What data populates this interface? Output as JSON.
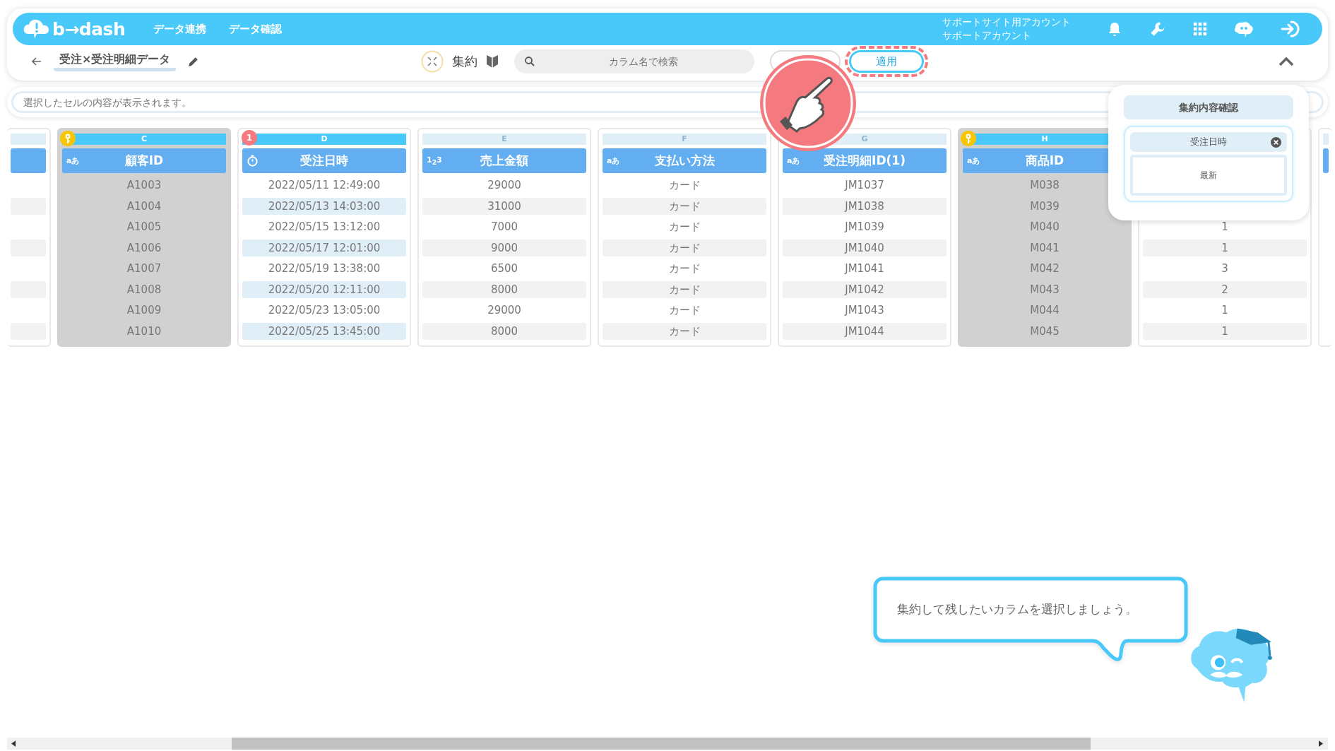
{
  "app": {
    "logo": "b→dash",
    "nav": [
      {
        "label": "データ連携"
      },
      {
        "label": "データ確認"
      }
    ],
    "account": [
      "サポートサイト用アカウント",
      "サポートアカウント"
    ]
  },
  "toolbar": {
    "title": "受注×受注明細データ",
    "mode_label": "集約",
    "search": {
      "placeholder": "カラム名で検索"
    },
    "apply_button": {
      "label": "適用",
      "highlighted": true
    }
  },
  "cell_view": {
    "placeholder": "選択したセルの内容が表示されます。"
  },
  "columns": [
    {
      "letter": "C",
      "kind": "text",
      "type_label": "aあ",
      "name": "顧客ID",
      "key": true,
      "cells": [
        "A1003",
        "A1004",
        "A1005",
        "A1006",
        "A1007",
        "A1008",
        "A1009",
        "A1010"
      ]
    },
    {
      "letter": "D",
      "kind": "datetime",
      "name": "受注日時",
      "key": false,
      "badge": "1",
      "cells": [
        "2022/05/11 12:49:00",
        "2022/05/13 14:03:00",
        "2022/05/15 13:12:00",
        "2022/05/17 12:01:00",
        "2022/05/19 13:38:00",
        "2022/05/20 12:11:00",
        "2022/05/23 13:05:00",
        "2022/05/25 13:45:00"
      ]
    },
    {
      "letter": "E",
      "kind": "number",
      "type_label": "1$_{2}$3",
      "name": "売上金額",
      "key": false,
      "cells": [
        "29000",
        "31000",
        "7000",
        "9000",
        "6500",
        "8000",
        "29000",
        "8000"
      ]
    },
    {
      "letter": "F",
      "kind": "text",
      "type_label": "aあ",
      "name": "支払い方法",
      "key": false,
      "cells": [
        "カード",
        "カード",
        "カード",
        "カード",
        "カード",
        "カード",
        "カード",
        "カード"
      ]
    },
    {
      "letter": "G",
      "kind": "text",
      "type_label": "aあ",
      "name": "受注明細ID(1)",
      "key": false,
      "cells": [
        "JM1037",
        "JM1038",
        "JM1039",
        "JM1040",
        "JM1041",
        "JM1042",
        "JM1043",
        "JM1044"
      ]
    },
    {
      "letter": "H",
      "kind": "text",
      "type_label": "aあ",
      "name": "商品ID",
      "key": true,
      "cells": [
        "M038",
        "M039",
        "M040",
        "M041",
        "M042",
        "M043",
        "M044",
        "M045"
      ]
    },
    {
      "key": false,
      "cells": [
        null,
        null,
        "1",
        "1",
        "3",
        "2",
        "1",
        "1"
      ]
    }
  ],
  "aggregation_panel": {
    "title": "集約内容確認",
    "items": [
      {
        "label": "受注日時",
        "method": "最新"
      }
    ]
  },
  "guide": {
    "message": "集約して残したいカラムを選択しましょう。"
  }
}
